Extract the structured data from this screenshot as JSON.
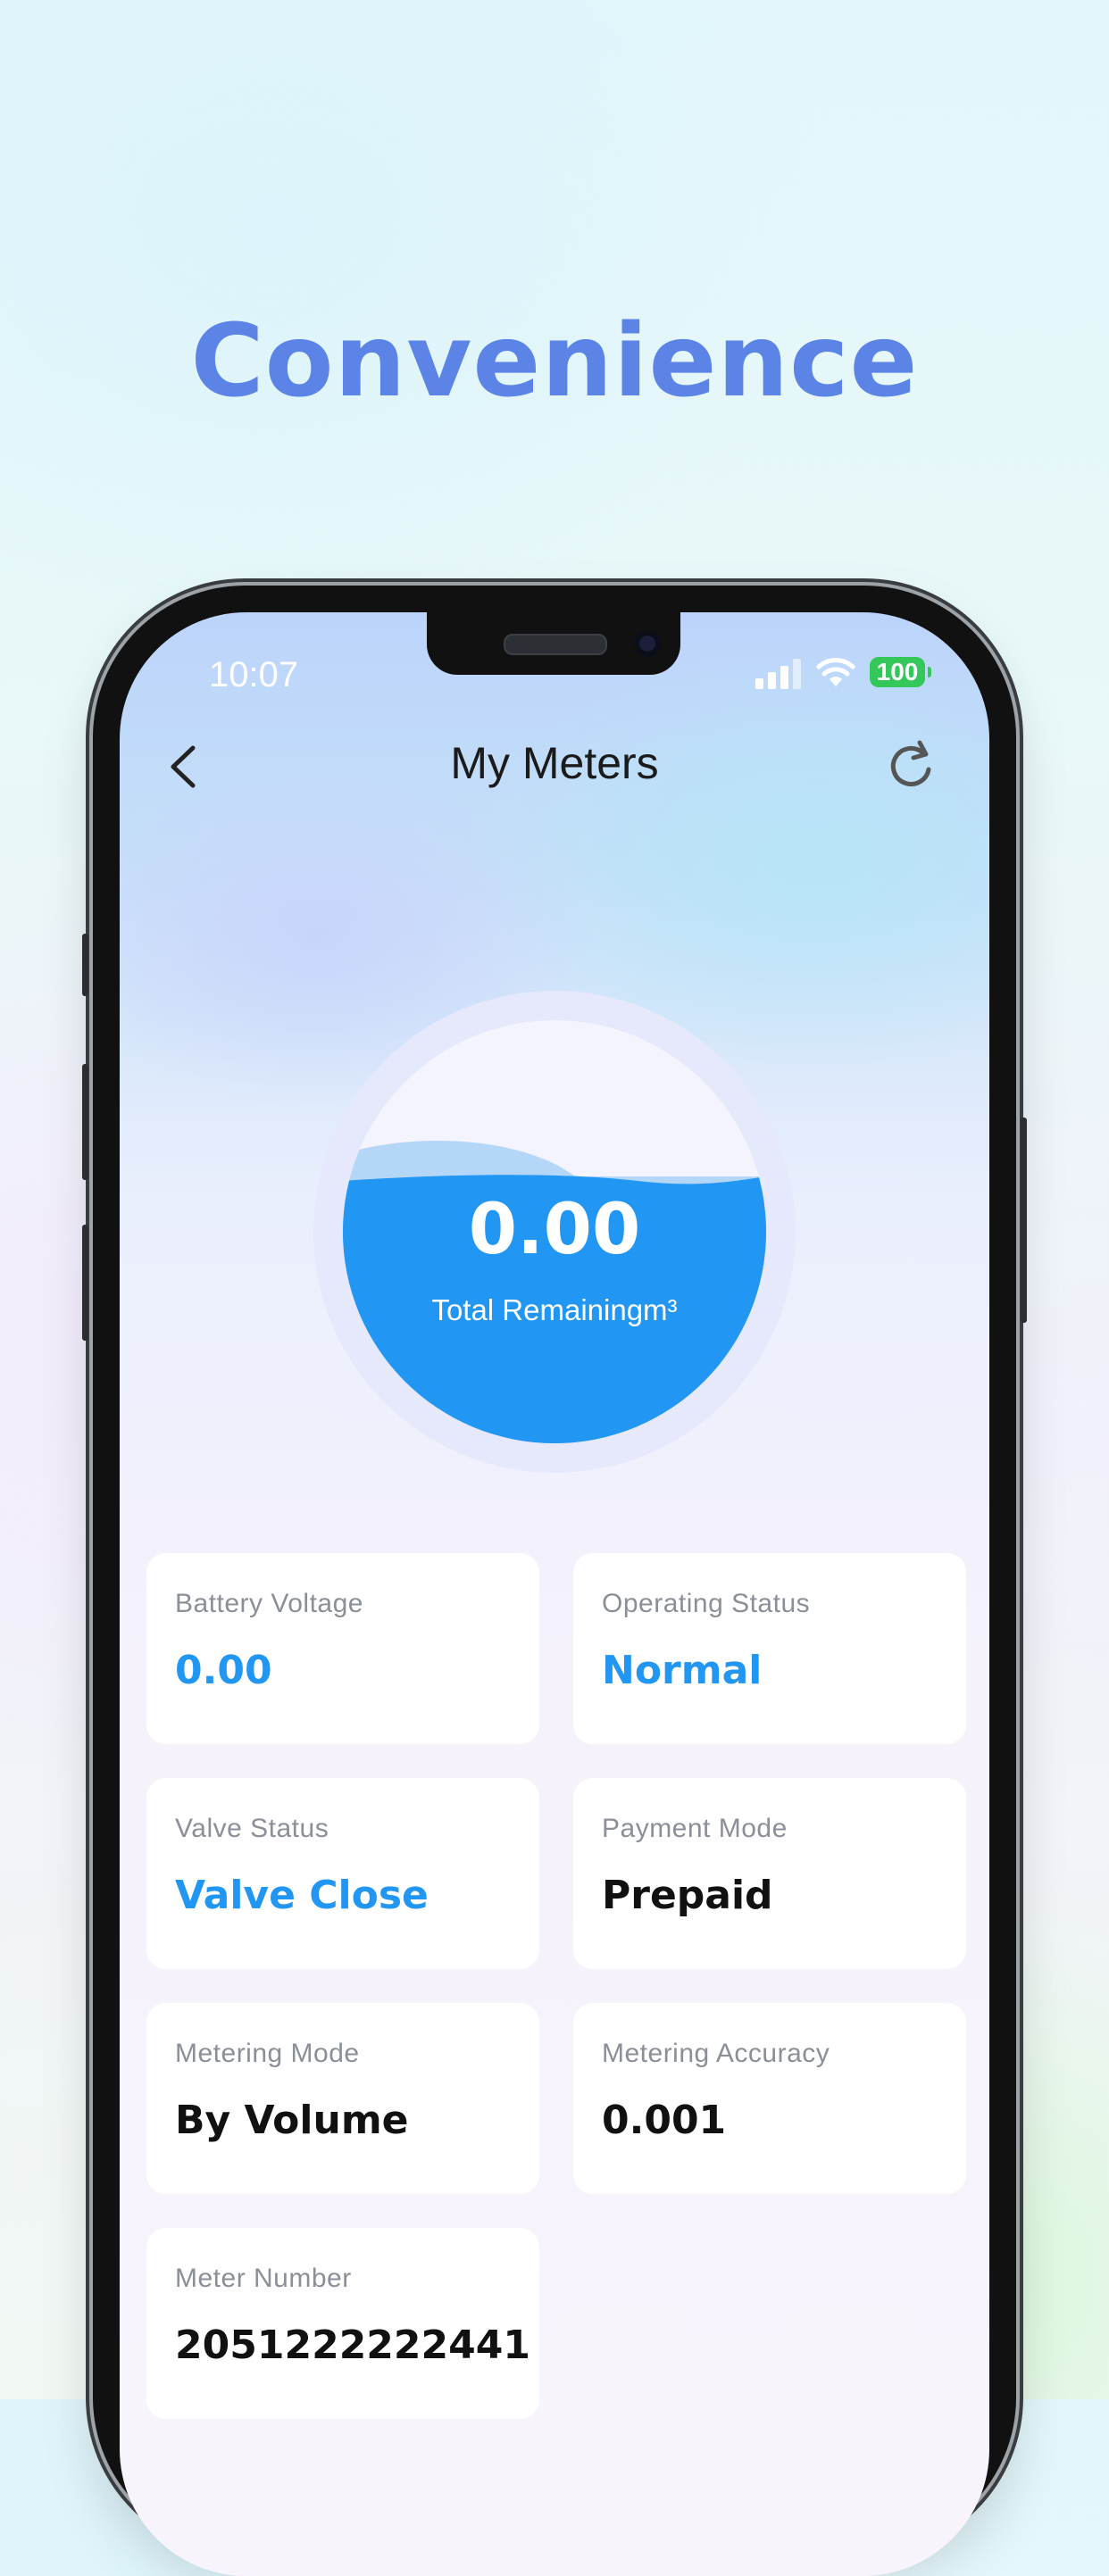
{
  "headline": "Convenience",
  "status_bar": {
    "time": "10:07",
    "battery": "100"
  },
  "header": {
    "title": "My Meters",
    "back_icon": "chevron-left-icon",
    "refresh_icon": "refresh-icon"
  },
  "gauge": {
    "value": "0.00",
    "label": "Total Remainingm³",
    "fill_fraction": 0.62
  },
  "cards": [
    {
      "label": "Battery Voltage",
      "value": "0.00"
    },
    {
      "label": "Operating Status",
      "value": "Normal"
    },
    {
      "label": "Valve Status",
      "value": "Valve Close"
    },
    {
      "label": "Payment Mode",
      "value": "Prepaid"
    },
    {
      "label": "Metering Mode",
      "value": "By Volume"
    },
    {
      "label": "Metering Accuracy",
      "value": "0.001"
    },
    {
      "label": "Meter Number",
      "value": "2051222222441"
    }
  ],
  "colors": {
    "accent": "#2196f3",
    "headline": "#5b84e6",
    "water": "#2196f3"
  }
}
